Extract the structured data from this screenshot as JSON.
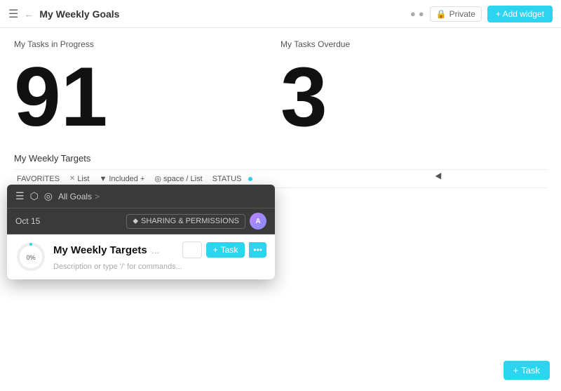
{
  "header": {
    "menu_icon": "☰",
    "back_icon": "←",
    "title": "My Weekly Goals",
    "dot1": "●",
    "dot2": "●",
    "private_icon": "🔒",
    "private_label": "Private",
    "add_widget_label": "+ Add widget"
  },
  "stats": {
    "in_progress_label": "My Tasks in Progress",
    "in_progress_value": "91",
    "overdue_label": "My Tasks Overdue",
    "overdue_value": "3"
  },
  "targets": {
    "title": "My Weekly Targets",
    "filter_favorites": "FAVORITES",
    "filter_list": "List",
    "filter_included": "Included +",
    "filter_space": "space / List",
    "filter_status": "STATUS",
    "filter_dot_active": true
  },
  "popup": {
    "icons": [
      "☰",
      "⬡",
      "◎"
    ],
    "breadcrumb_part1": "All Goals",
    "breadcrumb_sep": ">",
    "date": "Oct 15",
    "sharing_icon": "⬥",
    "sharing_label": "SHARING & PERMISSIONS",
    "progress_pct": "0%",
    "title": "My Weekly Targets",
    "ellipsis": "...",
    "action_btn": "+ Task",
    "description": "Description or type '/' for commands..."
  },
  "bottom": {
    "add_task_icon": "+",
    "add_task_label": "Task"
  }
}
